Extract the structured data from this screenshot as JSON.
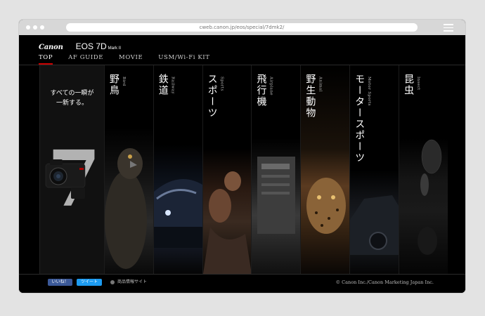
{
  "browser": {
    "url": "cweb.canon.jp/eos/special/7dmk2/"
  },
  "header": {
    "brand": "Canon",
    "product": "EOS 7D",
    "product_suffix": "Mark II"
  },
  "nav": {
    "items": [
      {
        "label": "TOP",
        "active": true
      },
      {
        "label": "AF GUIDE",
        "active": false
      },
      {
        "label": "MOVIE",
        "active": false
      },
      {
        "label": "USM/Wi-Fi KIT",
        "active": false
      }
    ]
  },
  "hero": {
    "line1": "すべての一瞬が",
    "line2": "一新する。",
    "big_numeral": "7"
  },
  "categories": [
    {
      "title": "野鳥",
      "subtitle": "Bird"
    },
    {
      "title": "鉄道",
      "subtitle": "Railway"
    },
    {
      "title": "スポーツ",
      "subtitle": "Sports"
    },
    {
      "title": "飛行機",
      "subtitle": "Airplane"
    },
    {
      "title": "野生動物",
      "subtitle": "Animal"
    },
    {
      "title": "モータースポーツ",
      "subtitle": "Motor Sports"
    },
    {
      "title": "昆虫",
      "subtitle": "Insect"
    }
  ],
  "footer": {
    "like_label": "いいね！",
    "tweet_label": "ツイート",
    "info_label": "商品情報サイト",
    "copyright": "© Canon Inc./Canon Marketing Japan Inc."
  },
  "colors": {
    "accent": "#cc0000",
    "background": "#000000",
    "facebook": "#3b5998",
    "twitter": "#1d9bf0"
  }
}
